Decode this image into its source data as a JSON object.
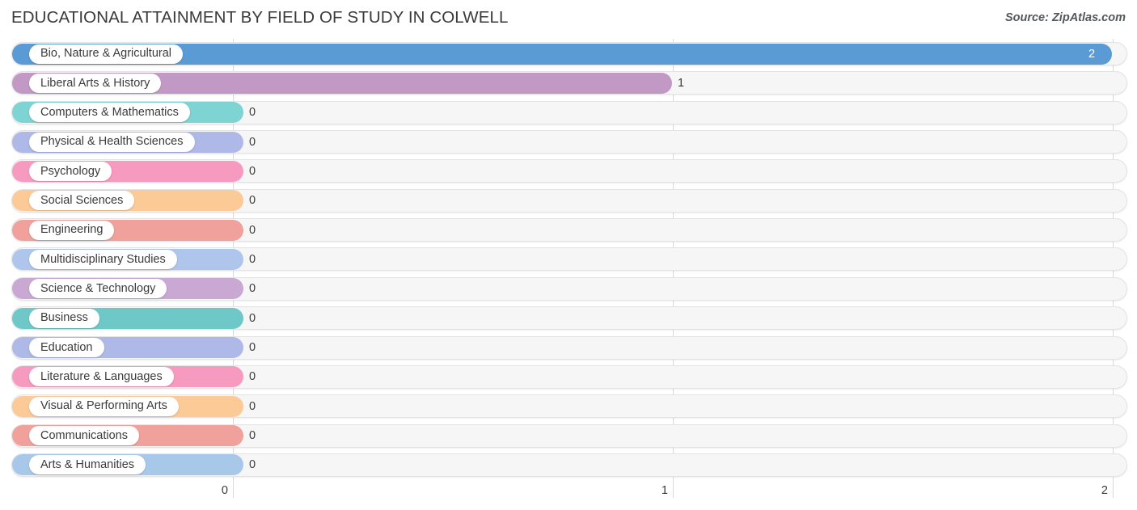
{
  "header": {
    "title": "EDUCATIONAL ATTAINMENT BY FIELD OF STUDY IN COLWELL",
    "source": "Source: ZipAtlas.com"
  },
  "chart_data": {
    "type": "bar",
    "orientation": "horizontal",
    "title": "EDUCATIONAL ATTAINMENT BY FIELD OF STUDY IN COLWELL",
    "xlabel": "",
    "ylabel": "",
    "xlim": [
      0,
      2
    ],
    "xticks": [
      0,
      1,
      2
    ],
    "xtick_labels": [
      "0",
      "1",
      "2"
    ],
    "grid": true,
    "legend": false,
    "categories": [
      "Bio, Nature & Agricultural",
      "Liberal Arts & History",
      "Computers & Mathematics",
      "Physical & Health Sciences",
      "Psychology",
      "Social Sciences",
      "Engineering",
      "Multidisciplinary Studies",
      "Science & Technology",
      "Business",
      "Education",
      "Literature & Languages",
      "Visual & Performing Arts",
      "Communications",
      "Arts & Humanities"
    ],
    "values": [
      2,
      1,
      0,
      0,
      0,
      0,
      0,
      0,
      0,
      0,
      0,
      0,
      0,
      0,
      0
    ],
    "value_labels": [
      "2",
      "1",
      "0",
      "0",
      "0",
      "0",
      "0",
      "0",
      "0",
      "0",
      "0",
      "0",
      "0",
      "0",
      "0"
    ],
    "colors": [
      "#5b9bd5",
      "#c199c4",
      "#7ed3d3",
      "#aeb9e8",
      "#f79ac0",
      "#fbca96",
      "#f0a19c",
      "#aec6ec",
      "#c9a8d4",
      "#6fc8c8",
      "#aeb9e8",
      "#f79ac0",
      "#fbca96",
      "#f0a19c",
      "#a8c8ea"
    ]
  },
  "rows": [
    {
      "label": "Bio, Nature & Agricultural",
      "value": "2",
      "color": "#5b9bd5",
      "inside": true
    },
    {
      "label": "Liberal Arts & History",
      "value": "1",
      "color": "#c199c4",
      "inside": false
    },
    {
      "label": "Computers & Mathematics",
      "value": "0",
      "color": "#7ed3d3",
      "inside": false
    },
    {
      "label": "Physical & Health Sciences",
      "value": "0",
      "color": "#aeb9e8",
      "inside": false
    },
    {
      "label": "Psychology",
      "value": "0",
      "color": "#f79ac0",
      "inside": false
    },
    {
      "label": "Social Sciences",
      "value": "0",
      "color": "#fbca96",
      "inside": false
    },
    {
      "label": "Engineering",
      "value": "0",
      "color": "#f0a19c",
      "inside": false
    },
    {
      "label": "Multidisciplinary Studies",
      "value": "0",
      "color": "#aec6ec",
      "inside": false
    },
    {
      "label": "Science & Technology",
      "value": "0",
      "color": "#c9a8d4",
      "inside": false
    },
    {
      "label": "Business",
      "value": "0",
      "color": "#6fc8c8",
      "inside": false
    },
    {
      "label": "Education",
      "value": "0",
      "color": "#aeb9e8",
      "inside": false
    },
    {
      "label": "Literature & Languages",
      "value": "0",
      "color": "#f79ac0",
      "inside": false
    },
    {
      "label": "Visual & Performing Arts",
      "value": "0",
      "color": "#fbca96",
      "inside": false
    },
    {
      "label": "Communications",
      "value": "0",
      "color": "#f0a19c",
      "inside": false
    },
    {
      "label": "Arts & Humanities",
      "value": "0",
      "color": "#a8c8ea",
      "inside": false
    }
  ],
  "axis": {
    "ticks": [
      "0",
      "1",
      "2"
    ]
  }
}
